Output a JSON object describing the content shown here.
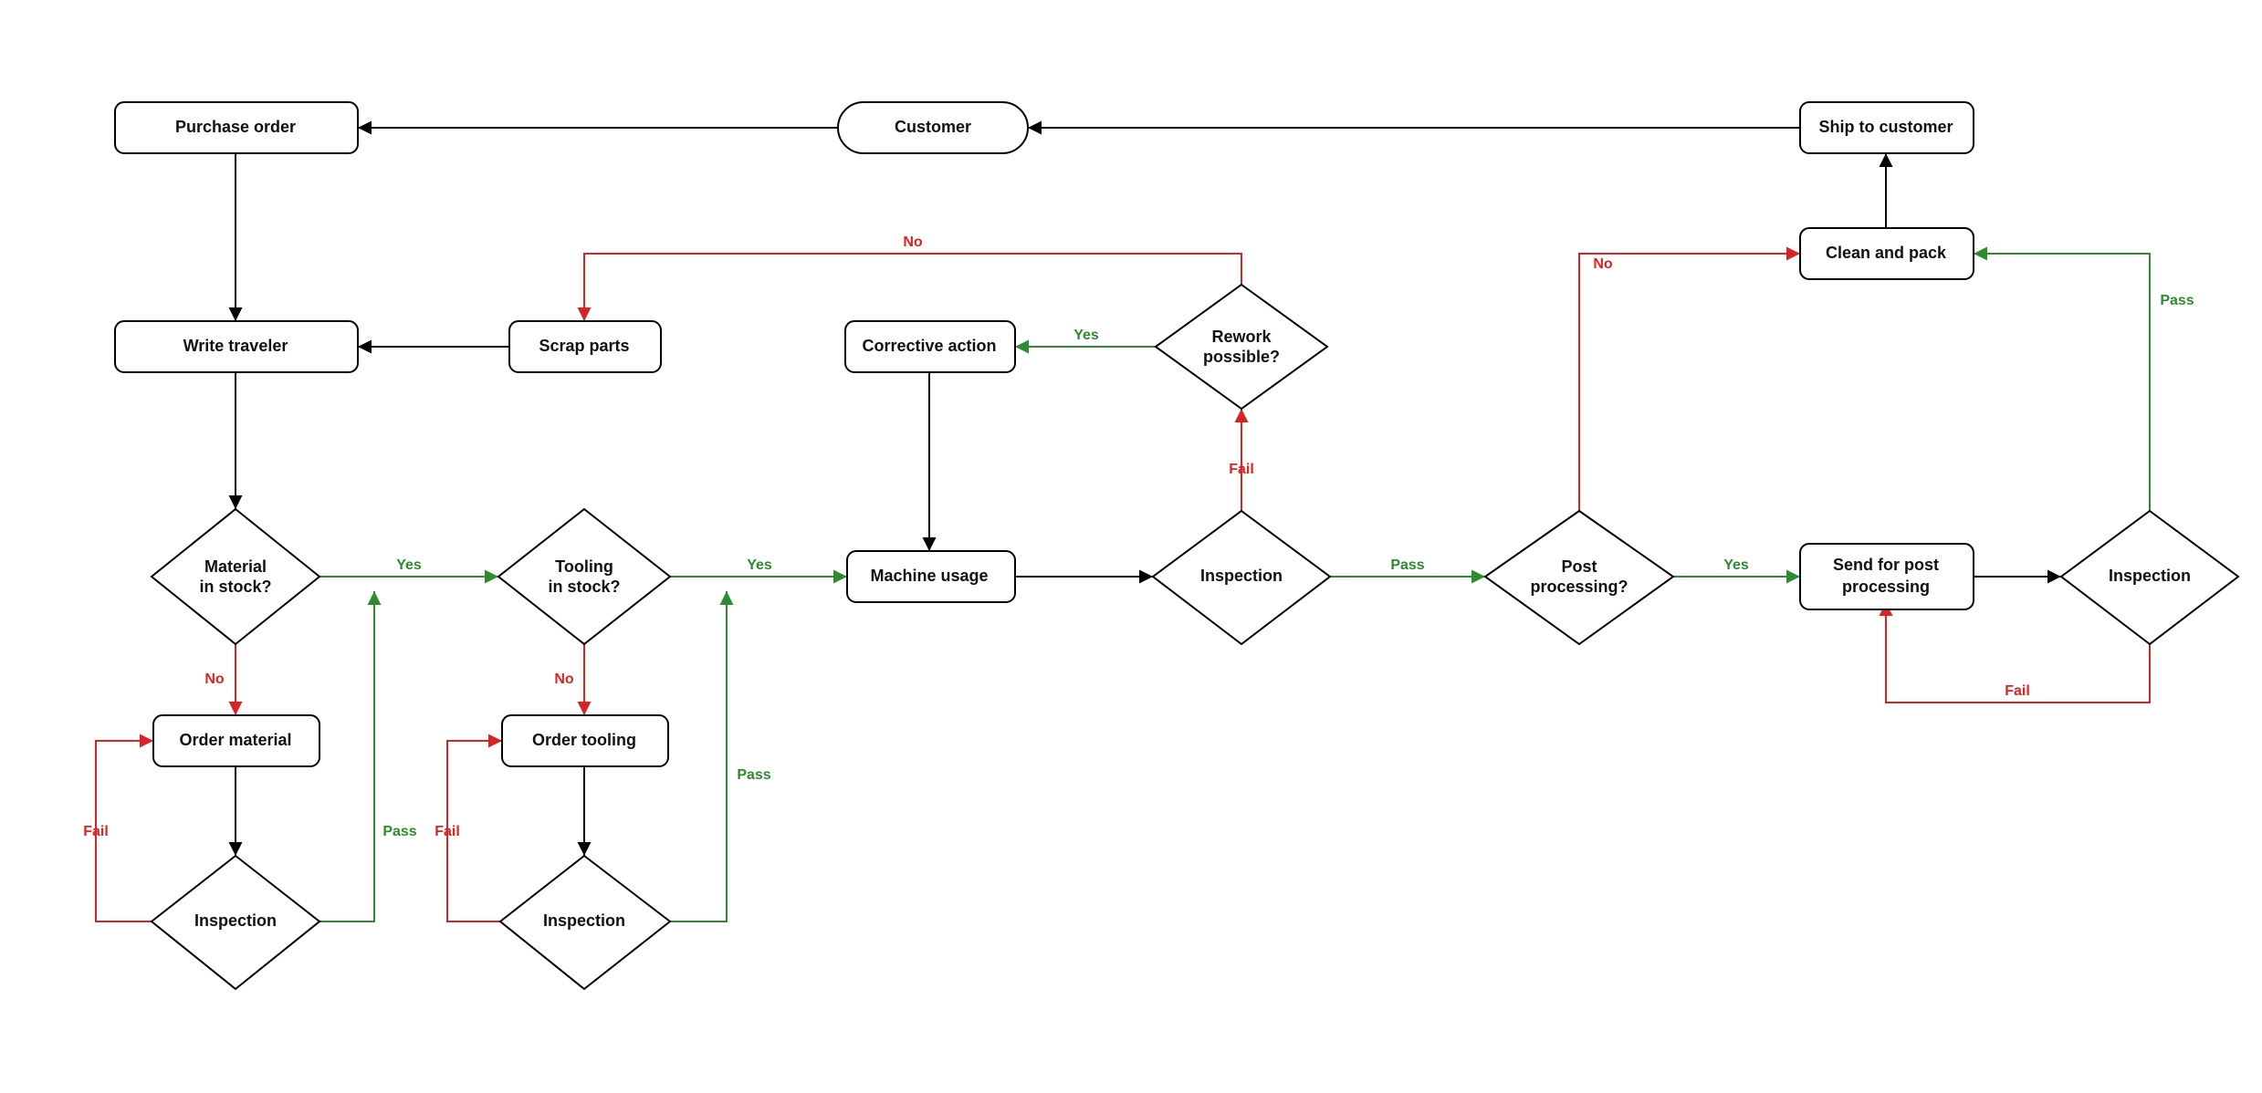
{
  "nodes": {
    "purchase_order": "Purchase order",
    "customer": "Customer",
    "ship_to_customer": "Ship to customer",
    "write_traveler": "Write traveler",
    "scrap_parts": "Scrap parts",
    "corrective_action": "Corrective action",
    "rework_possible": "Rework possible?",
    "clean_and_pack": "Clean and pack",
    "material_in_stock": "Material in stock?",
    "tooling_in_stock": "Tooling in stock?",
    "machine_usage": "Machine usage",
    "inspection_main": "Inspection",
    "post_processing": "Post processing?",
    "send_for_post": "Send for post processing",
    "inspection_post": "Inspection",
    "order_material": "Order material",
    "order_tooling": "Order tooling",
    "inspection_mat": "Inspection",
    "inspection_tool": "Inspection"
  },
  "edges": {
    "yes": "Yes",
    "no": "No",
    "pass": "Pass",
    "fail": "Fail"
  }
}
